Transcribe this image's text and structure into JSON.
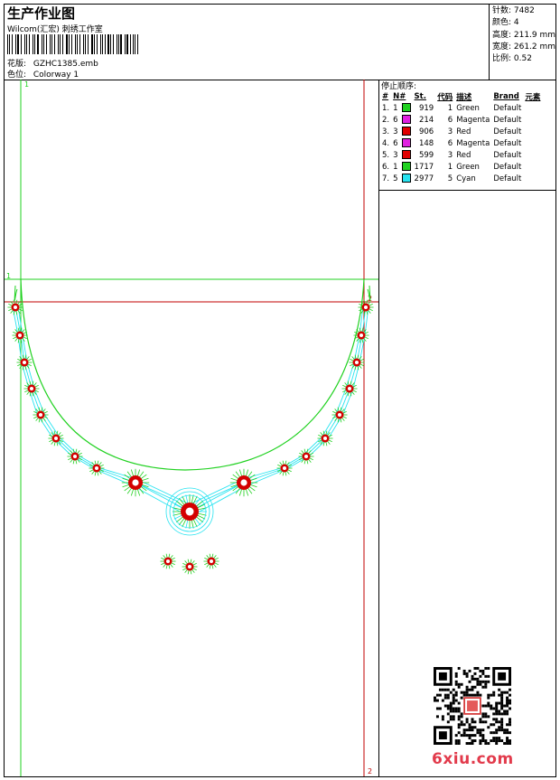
{
  "header": {
    "title": "生产作业图",
    "subtitle": "Wilcom(汇宏) 刺绣工作室",
    "pattern_label": "花版:",
    "pattern_value": "GZHC1385.emb",
    "colorway_label": "色位:",
    "colorway_value": "Colorway 1"
  },
  "stats": {
    "stitches": "针数: 7482",
    "colors": "颜色: 4",
    "height": "高度: 211.9 mm",
    "width": "宽度: 261.2 mm",
    "scale": "比例: 0.52"
  },
  "canvas": {
    "guide_markers": {
      "top": "1",
      "left": "1",
      "right_mid": "2",
      "right_bottom": "2"
    },
    "colors": {
      "green": "#1fd11f",
      "red": "#d40000",
      "cyan": "#27e3f0",
      "dark_red": "#c00000"
    }
  },
  "sequence": {
    "title": "停止顺序:",
    "headers": [
      "#",
      "N#",
      "St.",
      "代码",
      "描述",
      "Brand",
      "元素"
    ],
    "rows": [
      {
        "idx": "1.",
        "n": "1",
        "color": "#1fd11f",
        "st": "919",
        "code": "1",
        "desc": "Green",
        "brand": "Default"
      },
      {
        "idx": "2.",
        "n": "6",
        "color": "#e020e0",
        "st": "214",
        "code": "6",
        "desc": "Magenta",
        "brand": "Default"
      },
      {
        "idx": "3.",
        "n": "3",
        "color": "#e00000",
        "st": "906",
        "code": "3",
        "desc": "Red",
        "brand": "Default"
      },
      {
        "idx": "4.",
        "n": "6",
        "color": "#e020e0",
        "st": "148",
        "code": "6",
        "desc": "Magenta",
        "brand": "Default"
      },
      {
        "idx": "5.",
        "n": "3",
        "color": "#e00000",
        "st": "599",
        "code": "3",
        "desc": "Red",
        "brand": "Default"
      },
      {
        "idx": "6.",
        "n": "1",
        "color": "#1fd11f",
        "st": "1717",
        "code": "1",
        "desc": "Green",
        "brand": "Default"
      },
      {
        "idx": "7.",
        "n": "5",
        "color": "#27e3f0",
        "st": "2977",
        "code": "5",
        "desc": "Cyan",
        "brand": "Default"
      }
    ]
  },
  "watermark": "6xiu.com"
}
